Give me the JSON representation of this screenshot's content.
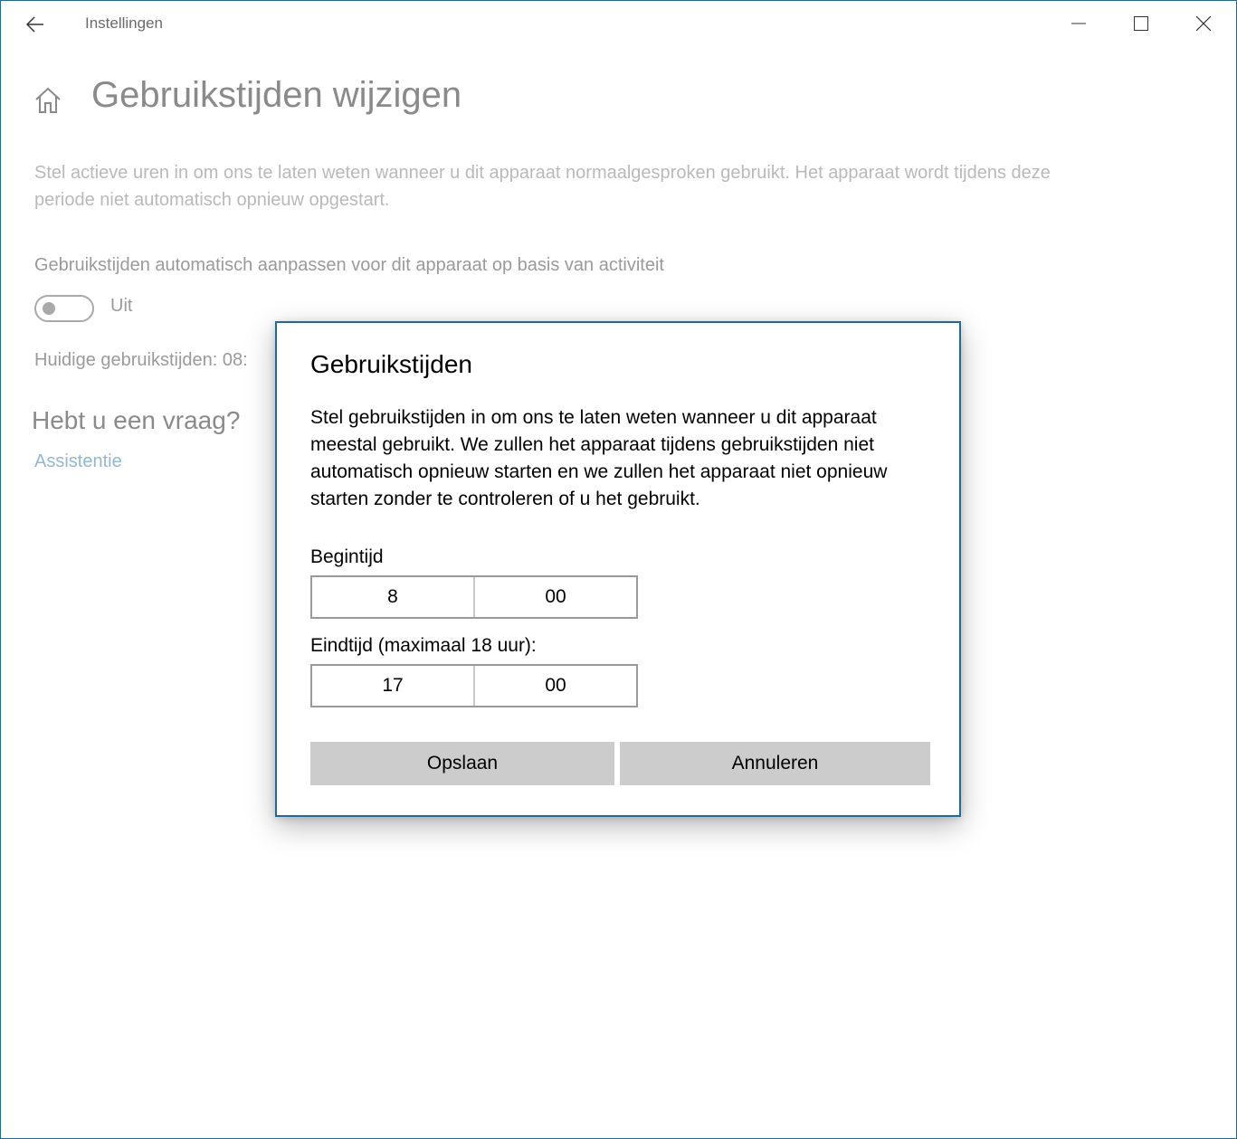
{
  "window": {
    "title": "Instellingen"
  },
  "page": {
    "title": "Gebruikstijden wijzigen",
    "description": "Stel actieve uren in om ons te laten weten wanneer u dit apparaat normaalgesproken gebruikt. Het apparaat wordt tijdens deze periode niet automatisch opnieuw opgestart.",
    "auto_adjust_label": "Gebruikstijden automatisch aanpassen voor dit apparaat op basis van activiteit",
    "toggle_state": "Uit",
    "current_hours": "Huidige gebruikstijden: 08:",
    "question_heading": "Hebt u een vraag?",
    "help_link": "Assistentie"
  },
  "dialog": {
    "title": "Gebruikstijden",
    "text": "Stel gebruikstijden in om ons te laten weten wanneer u dit apparaat meestal gebruikt. We zullen het apparaat tijdens gebruikstijden niet automatisch opnieuw starten en we zullen het apparaat niet opnieuw starten zonder te controleren of u het gebruikt.",
    "start_label": "Begintijd",
    "start_hour": "8",
    "start_minute": "00",
    "end_label": "Eindtijd (maximaal 18 uur):",
    "end_hour": "17",
    "end_minute": "00",
    "save_label": "Opslaan",
    "cancel_label": "Annuleren"
  },
  "icons": {
    "back": "back-arrow-icon",
    "minimize": "minimize-icon",
    "maximize": "maximize-icon",
    "close": "close-icon",
    "home": "home-icon"
  },
  "colors": {
    "accent_border": "#1f6a99",
    "link": "#8fb8d6",
    "button_bg": "#cccccc"
  }
}
